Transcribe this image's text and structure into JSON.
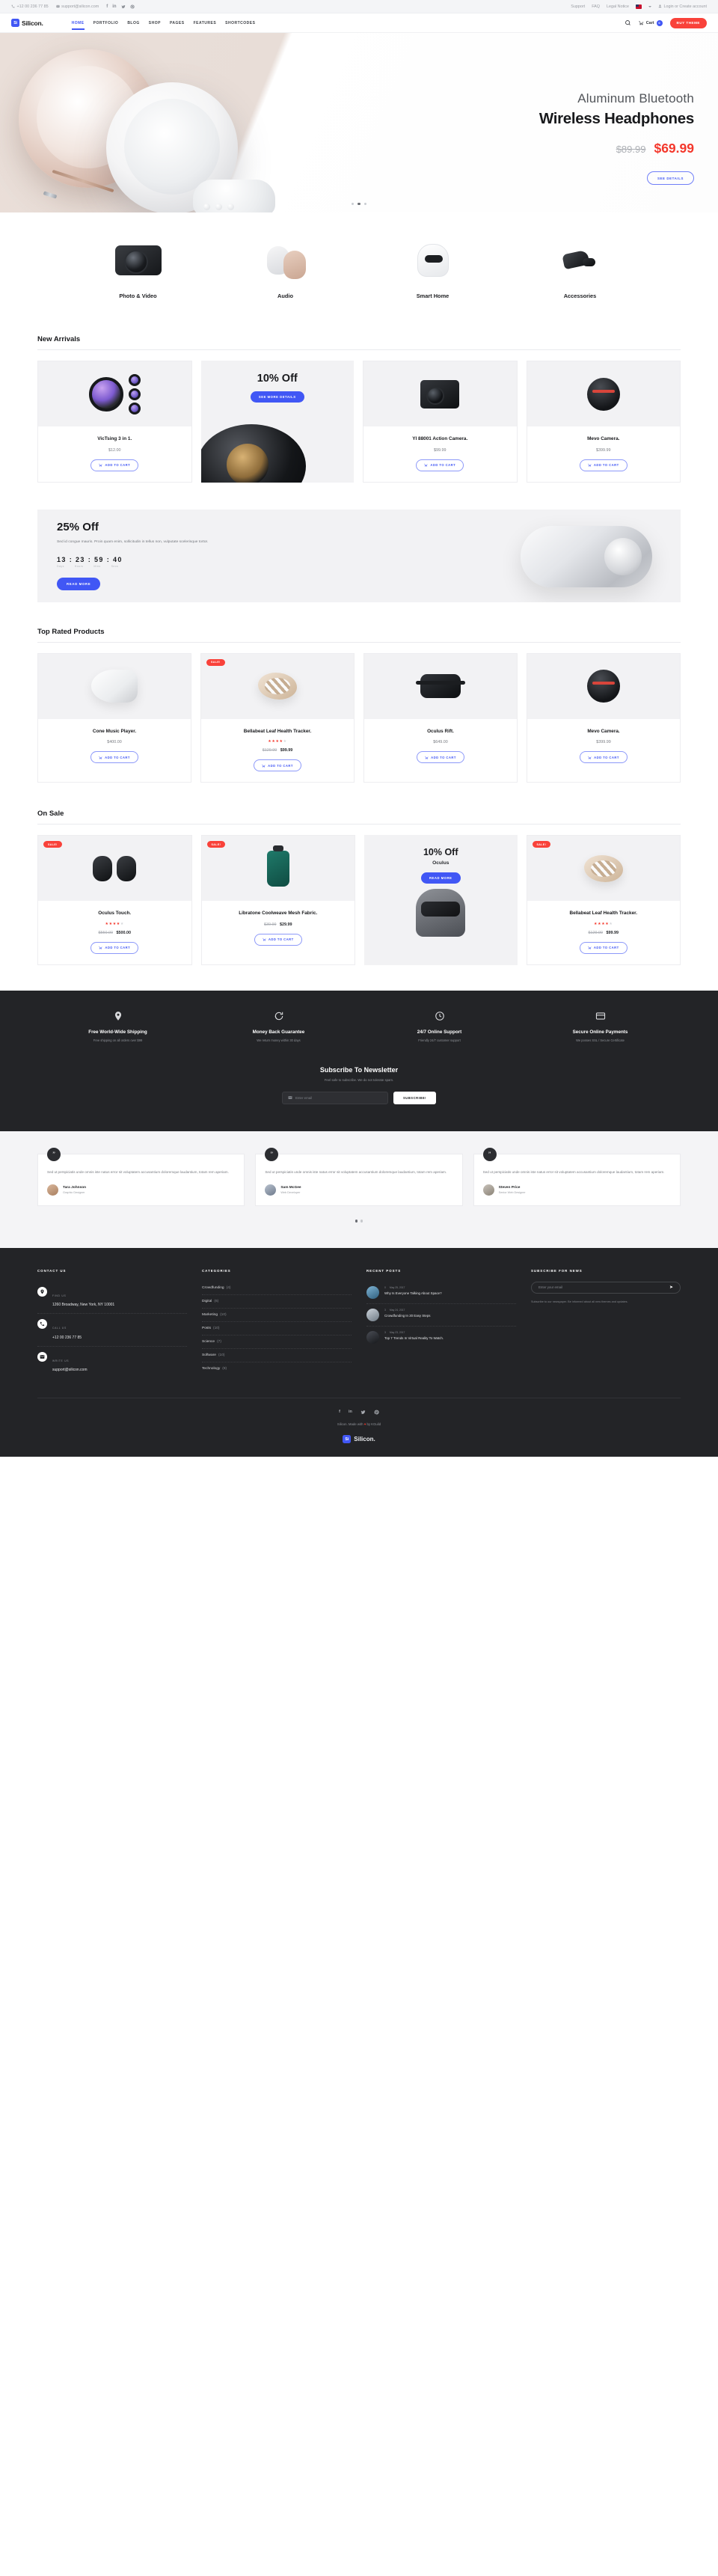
{
  "topbar": {
    "phone": "+12 00 236 77 85",
    "email": "support@silicon.com",
    "social": [
      "f",
      "in",
      "t",
      "p"
    ],
    "links": [
      "Support",
      "FAQ",
      "Legal Notice"
    ],
    "account": "Login or Create account"
  },
  "nav": {
    "brand": "Silicon.",
    "brand_mark": "Si",
    "items": [
      "HOME",
      "PORTFOLIO",
      "BLOG",
      "SHOP",
      "PAGES",
      "FEATURES",
      "SHORTCODES"
    ],
    "active": "HOME",
    "cart_label": "Cart",
    "cart_count": "0",
    "buy_label": "BUY THEME",
    "search_icon": "search-icon"
  },
  "hero": {
    "subtitle": "Aluminum Bluetooth",
    "title": "Wireless Headphones",
    "old_price": "$89.99",
    "new_price": "$69.99",
    "button": "SEE DETAILS",
    "slide_count": 3,
    "active_slide": 1
  },
  "categories": [
    {
      "label": "Photo & Video",
      "icon": "camera-icon"
    },
    {
      "label": "Audio",
      "icon": "headphones-icon"
    },
    {
      "label": "Smart Home",
      "icon": "speaker-icon"
    },
    {
      "label": "Accessories",
      "icon": "earbud-icon"
    }
  ],
  "new_arrivals": {
    "heading": "New Arrivals",
    "products": [
      {
        "name": "VicTsing 3 in 1.",
        "price": "$12.00",
        "cta": "ADD TO CART"
      },
      {
        "name": "YI 88001 Action Camera.",
        "price": "$99.99",
        "cta": "ADD TO CART"
      },
      {
        "name": "Mevo Camera.",
        "price": "$399.99",
        "cta": "ADD TO CART"
      }
    ],
    "promo": {
      "title": "10% Off",
      "button": "SEE MORE DETAILS"
    }
  },
  "banner": {
    "title": "25% Off",
    "desc": "Sed id congue mauris. Proin quam enim, sollicitudin in tellus non, vulputate scelerisque tortor.",
    "timer": "13 : 23 : 59 : 40",
    "units": [
      "Days",
      "Hours",
      "Mins",
      "Secs"
    ],
    "button": "READ MORE"
  },
  "top_rated": {
    "heading": "Top Rated Products",
    "products": [
      {
        "name": "Cone Music Player.",
        "price": "$400.00",
        "cta": "ADD TO CART",
        "sale": false,
        "stars": 0
      },
      {
        "name": "Bellabeat Leaf Health Tracker.",
        "old_price": "$129.99",
        "price": "$99.99",
        "cta": "ADD TO CART",
        "sale": true,
        "stars": 4
      },
      {
        "name": "Oculus Rift.",
        "price": "$649.00",
        "cta": "ADD TO CART",
        "sale": false,
        "stars": 0
      },
      {
        "name": "Mevo Camera.",
        "price": "$399.99",
        "cta": "ADD TO CART",
        "sale": false,
        "stars": 0
      }
    ]
  },
  "on_sale": {
    "heading": "On Sale",
    "products": [
      {
        "name": "Oculus Touch.",
        "old_price": "$550.00",
        "price": "$500.00",
        "cta": "ADD TO CART",
        "sale": true,
        "stars": 4
      },
      {
        "name": "Libratone Coolweave Mesh Fabric.",
        "old_price": "$39.99",
        "price": "$29.99",
        "cta": "ADD TO CART",
        "sale": true,
        "stars": 0
      },
      {
        "name": "Bellabeat Leaf Health Tracker.",
        "old_price": "$129.99",
        "price": "$99.99",
        "cta": "ADD TO CART",
        "sale": true,
        "stars": 4
      }
    ],
    "promo": {
      "title": "10% Off",
      "subtitle": "Oculus",
      "button": "READ MORE"
    }
  },
  "features": [
    {
      "title": "Free World-Wide Shipping",
      "desc": "Free shipping on all orders over $99",
      "icon": "location-pin-icon"
    },
    {
      "title": "Money Back Guarantee",
      "desc": "We return money within 30 days",
      "icon": "refresh-icon"
    },
    {
      "title": "24/7 Online Support",
      "desc": "Friendly 24/7 customer support",
      "icon": "clock-icon"
    },
    {
      "title": "Secure Online Payments",
      "desc": "We posses SSL / Secure Certificate",
      "icon": "credit-card-icon"
    }
  ],
  "newsletter": {
    "title": "Subscribe To Newsletter",
    "desc": "Feel safe to subscribe. We do not tolerate spam.",
    "placeholder": "Enter email",
    "button": "SUBSCRIBE!"
  },
  "testimonials": {
    "items": [
      {
        "quote": "Sed ut perspiciatis unde omnis iste natus error sit voluptatem accusantium doloremque laudantium, totam rem aperiam.",
        "name": "Tara Johnson",
        "role": "Graphic Designer"
      },
      {
        "quote": "Sed ut perspiciatis unde omnis iste natus error sit voluptatem accusantium doloremque laudantium, totam rem aperiam.",
        "name": "Sam McGee",
        "role": "Web Developer"
      },
      {
        "quote": "Sed ut perspiciatis unde omnis iste natus error sit voluptatem accusantium doloremque laudantium, totam rem aperiam.",
        "name": "Steven Price",
        "role": "Senior Web Designer"
      }
    ],
    "dot_count": 2,
    "active_dot": 0
  },
  "footer": {
    "contact": {
      "heading": "CONTACT US",
      "rows": [
        {
          "label": "FIND US",
          "value": "1260 Broadway, New York, NY 10001",
          "icon": "location-pin-icon"
        },
        {
          "label": "CALL US",
          "value": "+12 00 236 77 85",
          "icon": "phone-icon"
        },
        {
          "label": "WRITE US",
          "value": "support@silicon.com",
          "icon": "envelope-icon"
        }
      ]
    },
    "categories": {
      "heading": "CATEGORIES",
      "items": [
        {
          "name": "Crowdfunding",
          "count": "(4)"
        },
        {
          "name": "Digital",
          "count": "(6)"
        },
        {
          "name": "Marketing",
          "count": "(10)"
        },
        {
          "name": "Posts",
          "count": "(10)"
        },
        {
          "name": "Science",
          "count": "(7)"
        },
        {
          "name": "Software",
          "count": "(10)"
        },
        {
          "name": "Technology",
          "count": "(8)"
        }
      ]
    },
    "recent": {
      "heading": "RECENT POSTS",
      "items": [
        {
          "comments": "0",
          "date": "May 25, 2017",
          "title": "Why Is Everyone Talking About Space?"
        },
        {
          "comments": "3",
          "date": "May 24, 2017",
          "title": "Crowdfunding In 20 Easy Steps"
        },
        {
          "comments": "3",
          "date": "May 23, 2017",
          "title": "Top 7 Trends In Virtual Reality To Watch."
        }
      ]
    },
    "subscribe": {
      "heading": "SUBSCRIBE FOR NEWS",
      "placeholder": "Enter your email",
      "desc": "Subscribe to our newspaper. Be informed about all new themes and updates."
    },
    "social": [
      "f",
      "in",
      "t",
      "p"
    ],
    "made_pre": "Silicon. Made with",
    "made_heart": "♥",
    "made_post": "by KGuild",
    "logo": "Silicon.",
    "logo_mark": "Si"
  },
  "colors": {
    "accent": "#4157f5",
    "danger": "#f9423a",
    "dark": "#232427",
    "muted": "#8e9197"
  }
}
